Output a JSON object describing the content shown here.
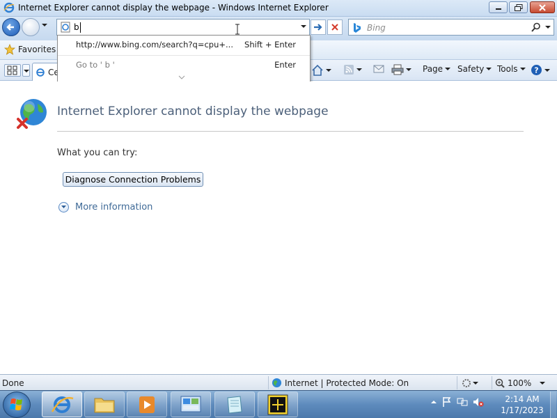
{
  "window": {
    "title": "Internet Explorer cannot display the webpage - Windows Internet Explorer"
  },
  "address_bar": {
    "value": "b"
  },
  "search_box": {
    "placeholder": "Bing"
  },
  "autocomplete": {
    "suggestion_url": "http://www.bing.com/search?q=cpu+...",
    "suggestion_shortcut": "Shift + Enter",
    "goto_text": "Go to ' b '",
    "goto_shortcut": "Enter"
  },
  "favorites_bar": {
    "favorites_label": "Favorites"
  },
  "tabs": [
    {
      "label": "Ce"
    }
  ],
  "command_bar": {
    "page_label": "Page",
    "safety_label": "Safety",
    "tools_label": "Tools"
  },
  "content": {
    "heading": "Internet Explorer cannot display the webpage",
    "try_label": "What you can try:",
    "diagnose_button": "Diagnose Connection Problems",
    "more_info": "More information"
  },
  "status_bar": {
    "status": "Done",
    "zone": "Internet | Protected Mode: On",
    "zoom": "100%"
  },
  "taskbar": {
    "time": "2:14 AM",
    "date": "1/17/2023",
    "pinned": [
      "internet-explorer",
      "windows-explorer",
      "media-player",
      "control-panel",
      "notepad",
      "asrock-utility"
    ]
  },
  "colors": {
    "heading": "#4c607a",
    "link": "#3f6a97",
    "taskbar": "#5e8bbd"
  }
}
